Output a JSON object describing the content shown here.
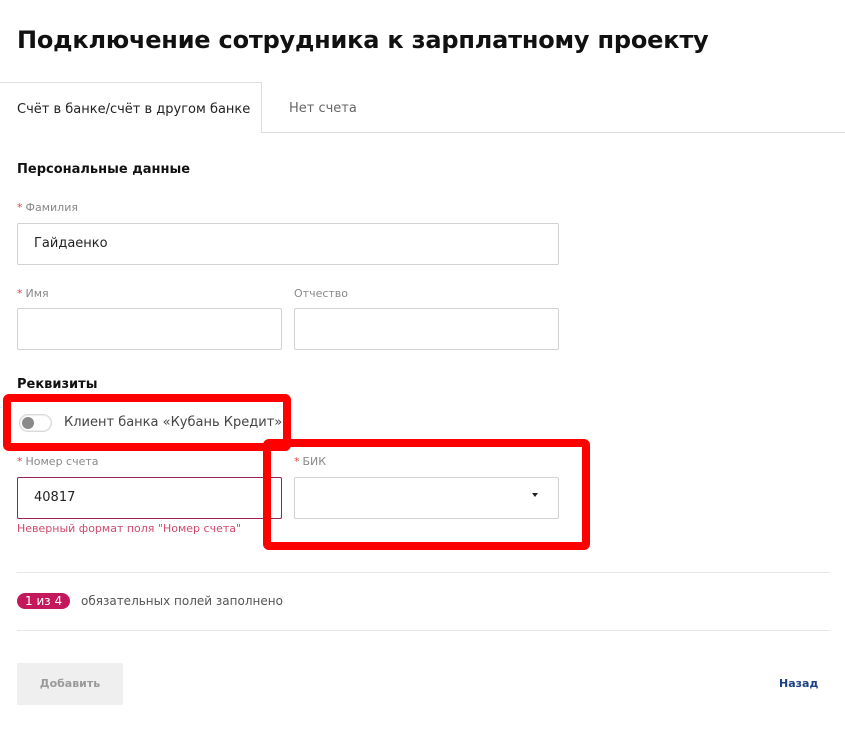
{
  "page": {
    "title": "Подключение сотрудника к зарплатному проекту"
  },
  "tabs": [
    {
      "label": "Счёт в банке/счёт в другом банке",
      "active": true
    },
    {
      "label": "Нет счета",
      "active": false
    }
  ],
  "personal": {
    "heading": "Персональные данные",
    "required_mark": "*",
    "surname": {
      "label": "Фамилия",
      "required": true,
      "value": "Гайдаенко"
    },
    "name": {
      "label": "Имя",
      "required": true,
      "value": ""
    },
    "patronymic": {
      "label": "Отчество",
      "required": false,
      "value": ""
    }
  },
  "requisites": {
    "heading": "Реквизиты",
    "client_toggle": {
      "label": "Клиент банка «Кубань Кредит»",
      "on": false
    },
    "account": {
      "label": "Номер счета",
      "required": true,
      "value": "40817",
      "error": "Неверный формат поля \"Номер счета\""
    },
    "bik": {
      "label": "БИК",
      "required": true,
      "value": ""
    }
  },
  "progress": {
    "badge": "1 из 4",
    "text": "обязательных полей заполнено",
    "filled": 1,
    "total": 4
  },
  "actions": {
    "add_label": "Добавить",
    "back_label": "Назад"
  },
  "colors": {
    "required": "#e2463e",
    "error_border": "#9a1f5a",
    "error_text": "#d04a6e",
    "badge": "#c4185c",
    "link": "#1c3f86",
    "highlight": "#ff0000"
  }
}
